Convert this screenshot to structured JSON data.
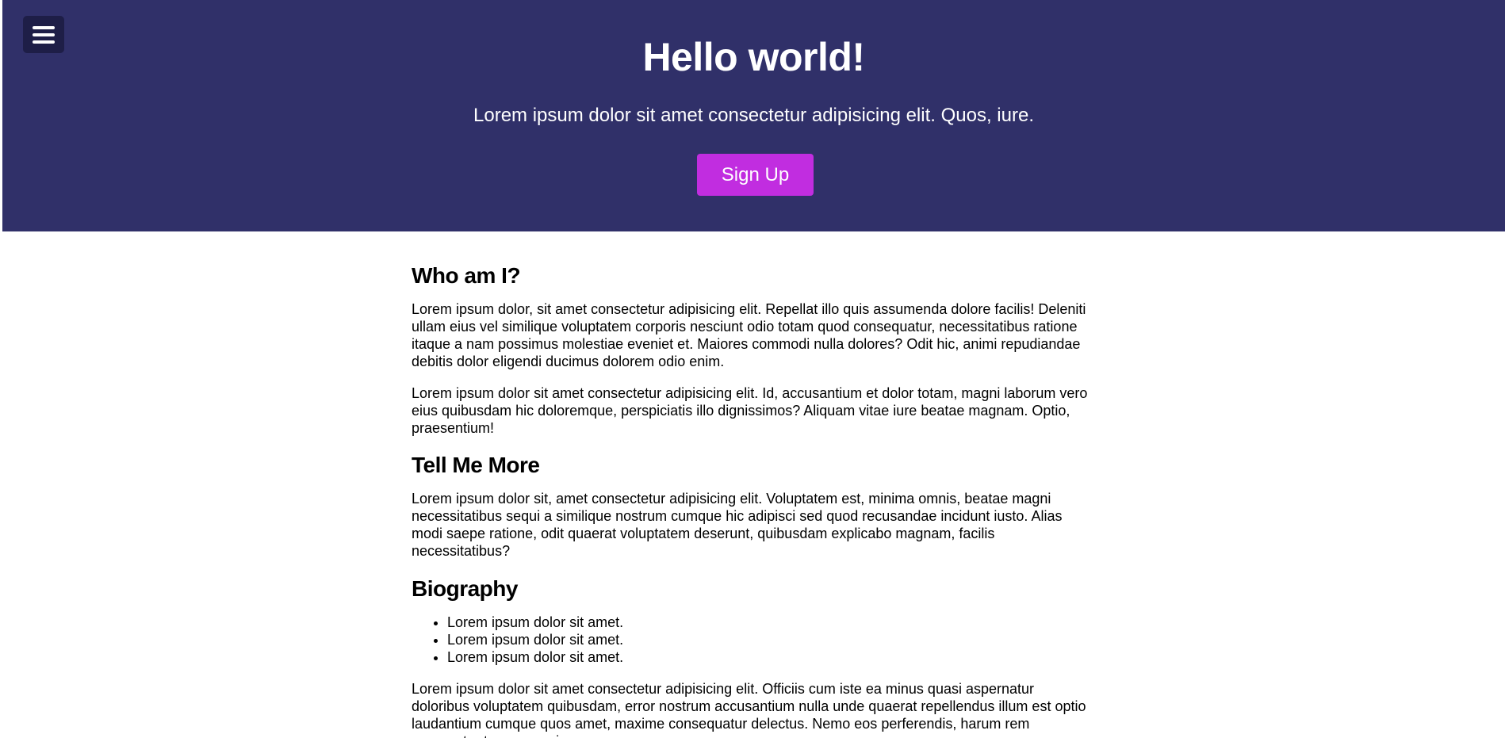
{
  "hero": {
    "title": "Hello world!",
    "subtitle": "Lorem ipsum dolor sit amet consectetur adipisicing elit. Quos, iure.",
    "signup_label": "Sign Up",
    "background_color": "#303069",
    "button_color": "#c12de0"
  },
  "menu": {
    "icon": "hamburger-menu-icon"
  },
  "sections": {
    "who": {
      "heading": "Who am I?",
      "paragraphs": [
        "Lorem ipsum dolor, sit amet consectetur adipisicing elit. Repellat illo quis assumenda dolore facilis! Deleniti ullam eius vel similique voluptatem corporis nesciunt odio totam quod consequatur, necessitatibus ratione itaque a nam possimus molestiae eveniet et. Maiores commodi nulla dolores? Odit hic, animi repudiandae debitis dolor eligendi ducimus dolorem odio enim.",
        "Lorem ipsum dolor sit amet consectetur adipisicing elit. Id, accusantium et dolor totam, magni laborum vero eius quibusdam hic doloremque, perspiciatis illo dignissimos? Aliquam vitae iure beatae magnam. Optio, praesentium!"
      ]
    },
    "tell": {
      "heading": "Tell Me More",
      "paragraph": "Lorem ipsum dolor sit, amet consectetur adipisicing elit. Voluptatem est, minima omnis, beatae magni necessitatibus sequi a similique nostrum cumque hic adipisci sed quod recusandae incidunt iusto. Alias modi saepe ratione, odit quaerat voluptatem deserunt, quibusdam explicabo magnam, facilis necessitatibus?"
    },
    "bio": {
      "heading": "Biography",
      "items": [
        "Lorem ipsum dolor sit amet.",
        "Lorem ipsum dolor sit amet.",
        "Lorem ipsum dolor sit amet."
      ],
      "paragraph": "Lorem ipsum dolor sit amet consectetur adipisicing elit. Officiis cum iste ea minus quasi aspernatur doloribus voluptatem quibusdam, error nostrum accusantium nulla unde quaerat repellendus illum est optio laudantium cumque quos amet, maxime consequatur delectus. Nemo eos perferendis, harum rem aspernatur tempora quis"
    }
  }
}
